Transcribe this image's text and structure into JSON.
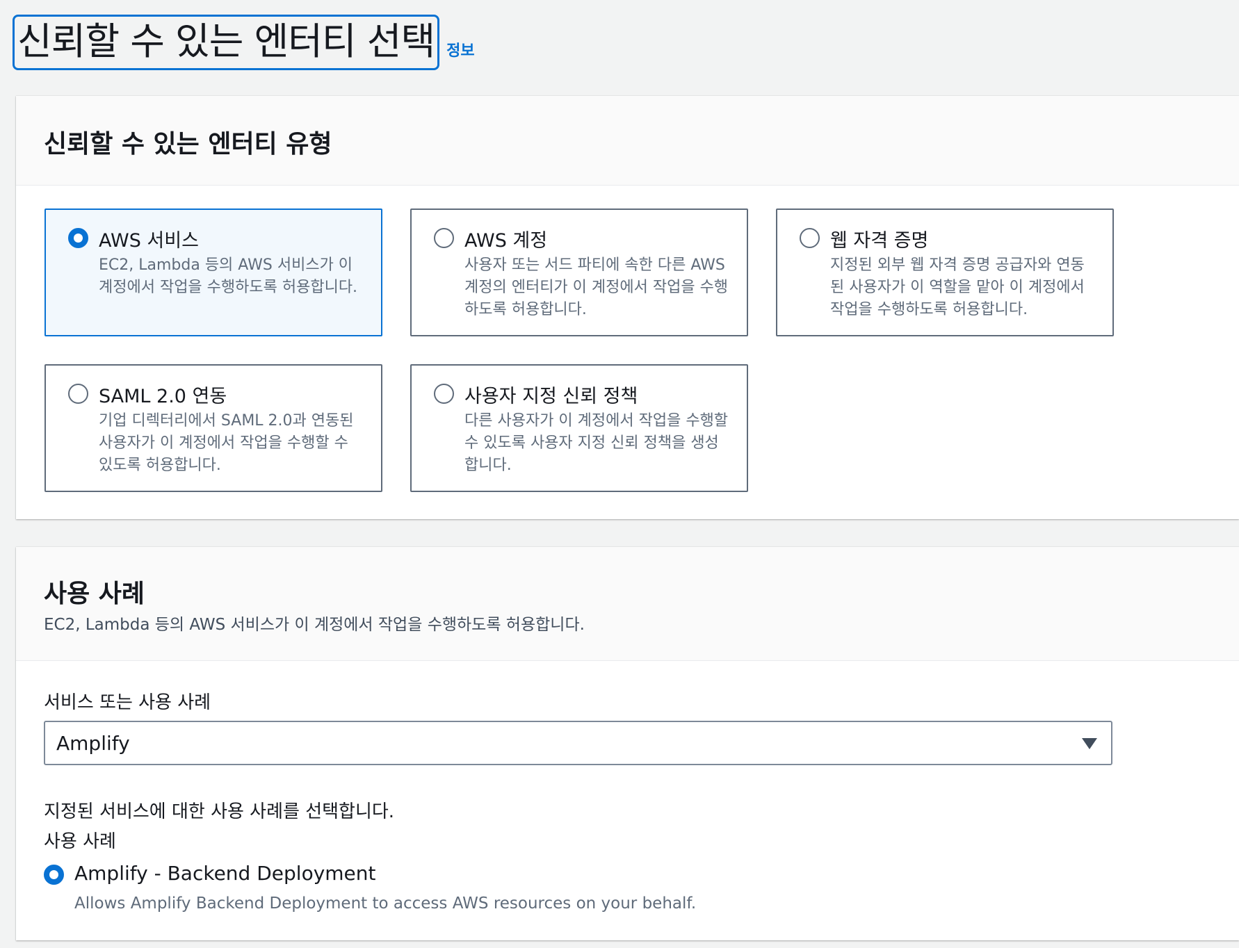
{
  "page": {
    "title": "신뢰할 수 있는 엔터티 선택",
    "info_link": "정보"
  },
  "entity_type": {
    "heading": "신뢰할 수 있는 엔터티 유형",
    "options": [
      {
        "label": "AWS 서비스",
        "description": "EC2, Lambda 등의 AWS 서비스가 이 계정에서 작업을 수행하도록 허용합니다.",
        "selected": true
      },
      {
        "label": "AWS 계정",
        "description": "사용자 또는 서드 파티에 속한 다른 AWS 계정의 엔터티가 이 계정에서 작업을 수행하도록 허용합니다.",
        "selected": false
      },
      {
        "label": "웹 자격 증명",
        "description": "지정된 외부 웹 자격 증명 공급자와 연동된 사용자가 이 역할을 맡아 이 계정에서 작업을 수행하도록 허용합니다.",
        "selected": false
      },
      {
        "label": "SAML 2.0 연동",
        "description": "기업 디렉터리에서 SAML 2.0과 연동된 사용자가 이 계정에서 작업을 수행할 수 있도록 허용합니다.",
        "selected": false
      },
      {
        "label": "사용자 지정 신뢰 정책",
        "description": "다른 사용자가 이 계정에서 작업을 수행할 수 있도록 사용자 지정 신뢰 정책을 생성합니다.",
        "selected": false
      }
    ]
  },
  "use_case": {
    "heading": "사용 사례",
    "description": "EC2, Lambda 등의 AWS 서비스가 이 계정에서 작업을 수행하도록 허용합니다.",
    "service_label": "서비스 또는 사용 사례",
    "service_value": "Amplify",
    "hint": "지정된 서비스에 대한 사용 사례를 선택합니다.",
    "sub_label": "사용 사례",
    "selected_case": {
      "title": "Amplify - Backend Deployment",
      "description": "Allows Amplify Backend Deployment to access AWS resources on your behalf."
    }
  },
  "colors": {
    "accent": "#0972d3",
    "selected_tile_bg": "#f2f8fd",
    "page_bg": "#f2f3f3"
  }
}
